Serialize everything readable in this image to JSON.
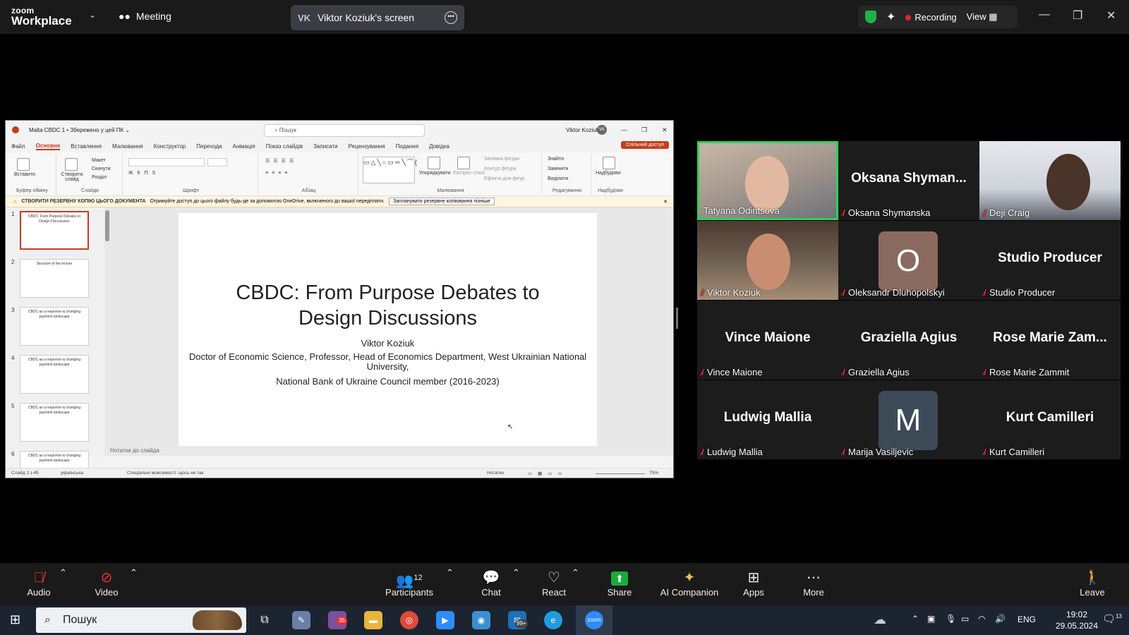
{
  "zoom": {
    "logo_line1": "zoom",
    "logo_line2": "Workplace",
    "meeting_label": "Meeting",
    "share_initials": "VK",
    "share_title": "Viktor Koziuk's screen",
    "recording_label": "Recording",
    "view_label": "View"
  },
  "ppt": {
    "file_title": "Malta CBDC 1 • Збережено у цей ПК ⌄",
    "search_placeholder": "Пошук",
    "user_name": "Viktor Koziuk",
    "user_initials": "VK",
    "tabs": [
      "Файл",
      "Основне",
      "Вставлення",
      "Малювання",
      "Конструктор",
      "Переходи",
      "Анімація",
      "Показ слайдів",
      "Записати",
      "Рецензування",
      "Подання",
      "Довідка"
    ],
    "share_button": "Спільний доступ",
    "ribbon": {
      "paste": "Вставити",
      "new_slide": "Створити слайд",
      "layout": "Макет",
      "reset": "Скинути",
      "section": "Розділ",
      "arrange": "Упорядкувати",
      "quick_styles": "Експрес-стилі",
      "shape_fill": "Заливка фігури",
      "shape_outline": "Контур фігури",
      "shape_effects": "Ефекти для фігур",
      "find": "Знайти",
      "replace": "Замінити",
      "select": "Виділити",
      "addins": "Надбудови",
      "group_clipboard": "Буфер обміну",
      "group_slides": "Слайди",
      "group_font": "Шрифт",
      "group_paragraph": "Абзац",
      "group_drawing": "Малювання",
      "group_editing": "Редагування",
      "group_addins": "Надбудови"
    },
    "infobar": {
      "title": "СТВОРИТИ РЕЗЕРВНУ КОПІЮ ЦЬОГО ДОКУМЕНТА",
      "text": "Отримуйте доступ до цього файлу будь-де за допомогою OneDrive, включеного до вашої передплати.",
      "button": "Запланувати резервне копіювання пізніше"
    },
    "thumbnails": [
      {
        "num": "1",
        "title": "CBDC: From Purpose Debates to Design Discussions"
      },
      {
        "num": "2",
        "title": "Structure of the lecture"
      },
      {
        "num": "3",
        "title": "CBDC as a response to changing payment landscape"
      },
      {
        "num": "4",
        "title": "CBDC as a response to changing payment landscape"
      },
      {
        "num": "5",
        "title": "CBDC as a response to changing payment landscape"
      },
      {
        "num": "6",
        "title": "CBDC as a response to changing payment landscape"
      }
    ],
    "slide": {
      "title": "CBDC: From Purpose Debates to Design Discussions",
      "author": "Viktor Koziuk",
      "affiliation": "Doctor of Economic Science, Professor, Head of Economics Department, West Ukrainian National University,",
      "nbu": "National Bank of Ukraine Council member (2016-2023)"
    },
    "notes_label": "Нотатки до слайда",
    "status": {
      "slide_count": "Слайд 1 з 45",
      "language": "українська",
      "accessibility": "Спеціальні можливості: щось не так",
      "notes": "Нотатки",
      "zoom": "75%"
    }
  },
  "participants": [
    {
      "name": "Tatyana Odintsova",
      "type": "video",
      "muted": false,
      "active": true
    },
    {
      "name": "Oksana Shymanska",
      "big": "Oksana Shyman...",
      "type": "name",
      "muted": true
    },
    {
      "name": "Deji Craig",
      "type": "video",
      "muted": true
    },
    {
      "name": "Viktor Koziuk",
      "type": "video",
      "muted": true
    },
    {
      "name": "Oleksandr Dluhopolskyi",
      "type": "avatar",
      "letter": "O",
      "color": "#8a6a5e",
      "muted": true
    },
    {
      "name": "Studio Producer",
      "big": "Studio Producer",
      "type": "name",
      "muted": true
    },
    {
      "name": "Vince Maione",
      "big": "Vince Maione",
      "type": "name",
      "muted": true
    },
    {
      "name": "Graziella Agius",
      "big": "Graziella Agius",
      "type": "name",
      "muted": true
    },
    {
      "name": "Rose Marie Zammit",
      "big": "Rose Marie Zam...",
      "type": "name",
      "muted": true
    },
    {
      "name": "Ludwig Mallia",
      "big": "Ludwig Mallia",
      "type": "name",
      "muted": true
    },
    {
      "name": "Marija Vasiljevic",
      "type": "avatar",
      "letter": "M",
      "color": "#3c4a58",
      "muted": true
    },
    {
      "name": "Kurt Camilleri",
      "big": "Kurt Camilleri",
      "type": "name",
      "muted": true
    }
  ],
  "toolbar": {
    "audio": "Audio",
    "video": "Video",
    "participants": "Participants",
    "participants_count": "12",
    "chat": "Chat",
    "react": "React",
    "share": "Share",
    "ai_companion": "AI Companion",
    "apps": "Apps",
    "more": "More",
    "leave": "Leave"
  },
  "taskbar": {
    "search_text": "Пошук",
    "viber_badge": "35",
    "mail_badge": "99+",
    "lang": "ENG",
    "time": "19:02",
    "date": "29.05.2024",
    "notif_count": "13"
  }
}
